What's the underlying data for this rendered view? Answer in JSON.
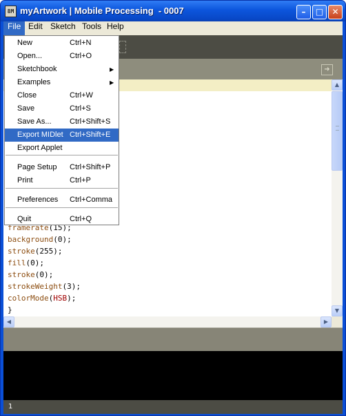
{
  "window": {
    "title": "myArtwork | Mobile Processing  - 0007",
    "icon_text": "8M",
    "controls": {
      "minimize_icon": "minimize-icon",
      "maximize_icon": "maximize-icon",
      "close_icon": "close-icon"
    }
  },
  "menubar": [
    {
      "label": "File",
      "active": true
    },
    {
      "label": "Edit"
    },
    {
      "label": "Sketch"
    },
    {
      "label": "Tools"
    },
    {
      "label": "Help"
    }
  ],
  "file_menu": [
    {
      "label": "New",
      "shortcut": "Ctrl+N"
    },
    {
      "label": "Open...",
      "shortcut": "Ctrl+O"
    },
    {
      "label": "Sketchbook",
      "shortcut": "",
      "submenu": true
    },
    {
      "label": "Examples",
      "shortcut": "",
      "submenu": true
    },
    {
      "label": "Close",
      "shortcut": "Ctrl+W"
    },
    {
      "label": "Save",
      "shortcut": "Ctrl+S"
    },
    {
      "label": "Save As...",
      "shortcut": "Ctrl+Shift+S"
    },
    {
      "label": "Export MIDlet",
      "shortcut": "Ctrl+Shift+E",
      "highlighted": true
    },
    {
      "label": "Export Applet",
      "shortcut": ""
    },
    {
      "label": "Page Setup",
      "shortcut": "Ctrl+Shift+P"
    },
    {
      "label": "Print",
      "shortcut": "Ctrl+P"
    },
    {
      "label": "Preferences",
      "shortcut": "Ctrl+Comma"
    },
    {
      "label": "Quit",
      "shortcut": "Ctrl+Q"
    }
  ],
  "code_lines": [
    [
      {
        "t": "framerate",
        "k": "kw"
      },
      {
        "t": "(15);"
      }
    ],
    [
      {
        "t": "background",
        "k": "kw"
      },
      {
        "t": "(0);"
      }
    ],
    [
      {
        "t": "stroke",
        "k": "kw"
      },
      {
        "t": "(255);"
      }
    ],
    [
      {
        "t": "fill",
        "k": "kw"
      },
      {
        "t": "(0);"
      }
    ],
    [
      {
        "t": "stroke",
        "k": "kw"
      },
      {
        "t": "(0);"
      }
    ],
    [
      {
        "t": "strokeWeight",
        "k": "kw"
      },
      {
        "t": "(3);"
      }
    ],
    [
      {
        "t": "colorMode",
        "k": "kw"
      },
      {
        "t": "("
      },
      {
        "t": "HSB",
        "k": "cs"
      },
      {
        "t": ");"
      }
    ],
    [
      {
        "t": "}"
      }
    ]
  ],
  "status": {
    "line_number": "1"
  },
  "colors": {
    "title_bar": "#0c55dc",
    "menu_highlight": "#316ac5",
    "toolbar": "#4c4c44",
    "console": "#000000",
    "keyword": "#8c4d10",
    "constant": "#a00000"
  }
}
